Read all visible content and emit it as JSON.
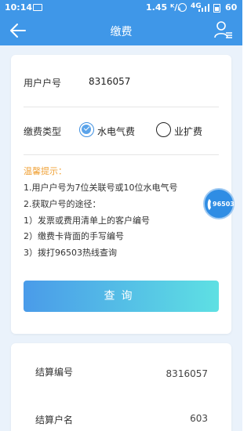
{
  "statusbar": {
    "time": "10:14",
    "speed": "1.45 ᴷ/ₛ",
    "signal": "4G",
    "battery": "60"
  },
  "header": {
    "title": "缴费"
  },
  "form": {
    "account_label": "用户户号",
    "account_value": "8316057",
    "type_label": "缴费类型",
    "option_utility": "水电气费",
    "option_expansion": "业扩费",
    "selected": "水电气费"
  },
  "tips": {
    "title": "温馨提示：",
    "lines": [
      "1.用户户号为7位关联号或10位水电气号",
      "2.获取户号的途径：",
      "1）发票或费用清单上的客户编号",
      "2）缴费卡背面的手写编号",
      "3）拨打96503热线查询"
    ]
  },
  "query_button": "查询",
  "hotline": "96503",
  "result": {
    "settle_no_label": "结算编号",
    "settle_no_value": "8316057",
    "settle_name_label": "结算户名",
    "settle_name_value": "603"
  },
  "colors": {
    "brand": "#3f97e8",
    "tip_title": "#f0a33a"
  }
}
